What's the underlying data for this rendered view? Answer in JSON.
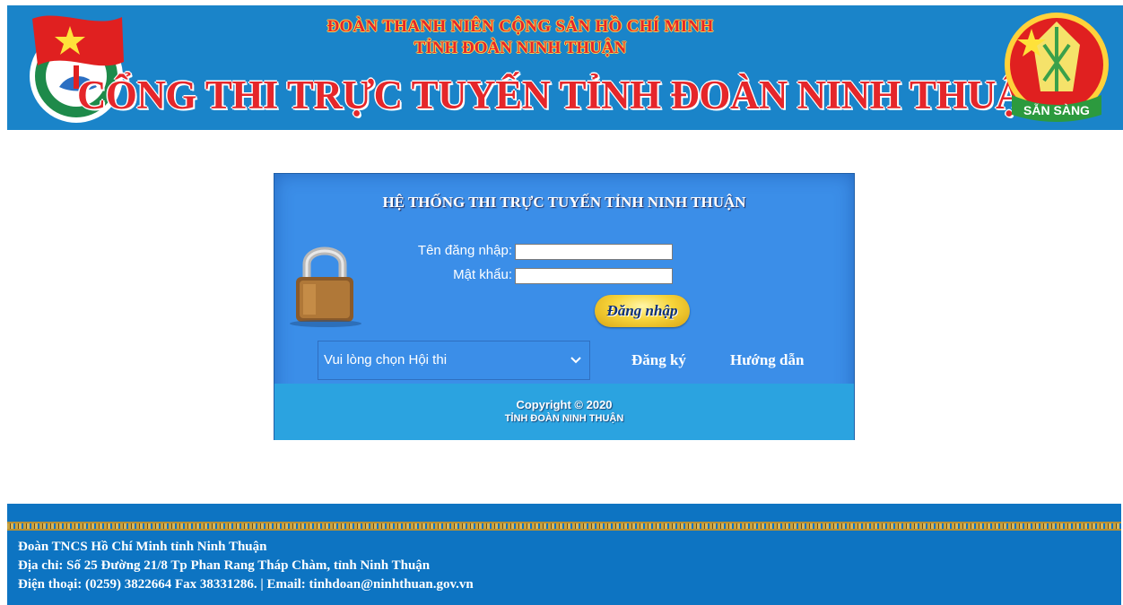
{
  "header": {
    "line1": "ĐOÀN THANH NIÊN CỘNG SẢN HỒ CHÍ MINH",
    "line2": "TỈNH ĐOÀN NINH THUẬN",
    "title": "CỔNG THI TRỰC TUYẾN TỈNH ĐOÀN NINH THUẬN",
    "left_logo_icon": "youth-union-emblem-icon",
    "right_logo_icon": "san-sang-badge-icon",
    "right_logo_text": "SẴN SÀNG",
    "colors": {
      "header_bg": "#1a84c9",
      "title_red": "#e5262a"
    }
  },
  "login": {
    "title": "HỆ THỐNG THI TRỰC TUYẾN TỈNH NINH THUẬN",
    "username_label": "Tên đăng nhập:",
    "password_label": "Mật khẩu:",
    "username_value": "",
    "password_value": "",
    "login_button": "Đăng nhập",
    "lock_icon": "padlock-icon",
    "contest_select": "Vui lòng chọn Hội thi",
    "register_link": "Đăng ký",
    "help_link": "Hướng dẫn",
    "copyright": "Copyright © 2020",
    "copyright_org": "TỈNH ĐOÀN NINH THUẬN",
    "colors": {
      "panel_bg": "#3b8ee8",
      "panel_footer_bg": "#2ba3e0"
    }
  },
  "footer": {
    "line1": "Đoàn TNCS Hồ Chí Minh tỉnh Ninh Thuận",
    "line2": "Địa chỉ: Số 25 Đường 21/8 Tp Phan Rang Tháp Chàm, tỉnh Ninh Thuận",
    "line3": "Điện thoại: (0259) 3822664 Fax 38331286. | Email: tinhdoan@ninhthuan.gov.vn",
    "colors": {
      "footer_bg": "#0d74c2"
    }
  }
}
